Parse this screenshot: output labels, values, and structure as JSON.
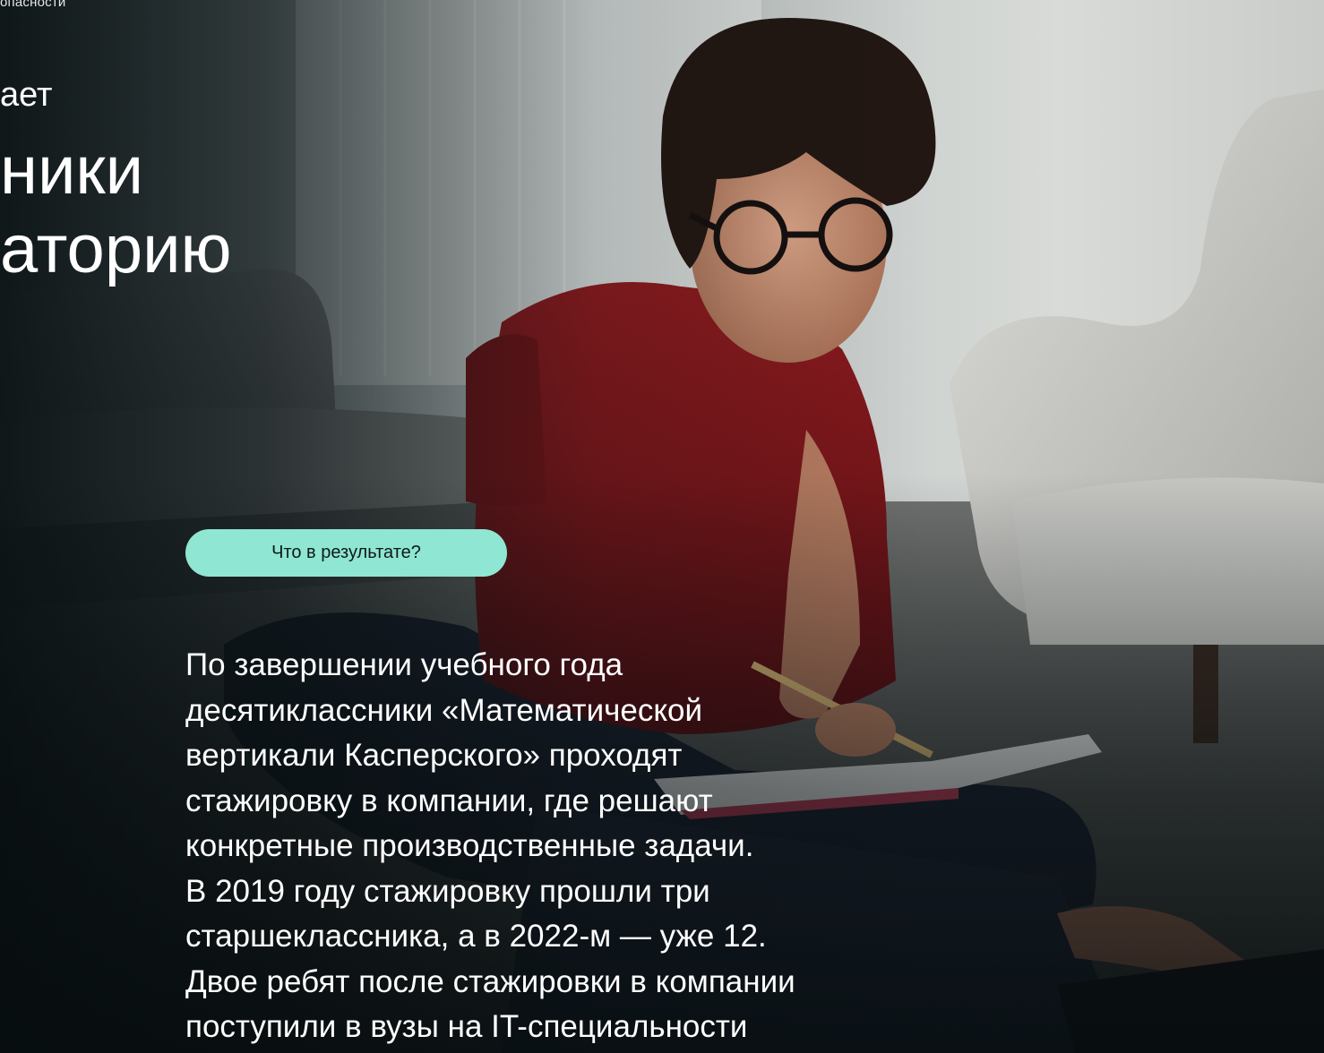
{
  "page": {
    "breadcrumb_fragment": "опасности",
    "kicker_fragment": "ает",
    "headline_lines": [
      "ники",
      "аторию"
    ]
  },
  "result_button": {
    "label": "Что в результате?",
    "color": "#8fe6d2"
  },
  "description": {
    "lines": [
      "По завершении учебного года",
      "десятиклассники «Математической",
      "вертикали Касперского» проходят",
      "стажировку в компании, где решают",
      "конкретные производственные задачи.",
      "В 2019 году стажировку прошли три",
      "старшеклассника, а в 2022-м — уже 12.",
      "Двое ребят после стажировки в компании",
      "поступили в вузы на IT-специальности"
    ]
  },
  "photo": {
    "alt": "",
    "shirt_color": "#7a1418"
  }
}
